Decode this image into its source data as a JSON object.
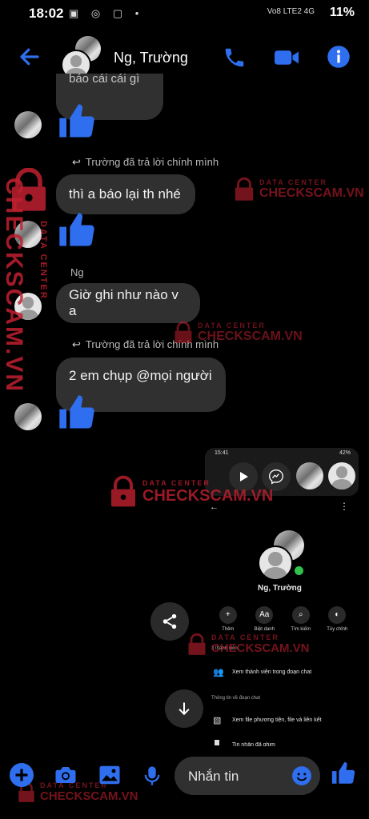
{
  "status_bar": {
    "time": "18:02",
    "battery": "11%",
    "network": "Vo8 LTE2 4G"
  },
  "header": {
    "title": "Ng, Trường"
  },
  "messages": {
    "msg1_partial": "báo cái cái gì",
    "reply_note_1": "Trường đã trả lời chính mình",
    "msg2": "thì a báo lại th nhé",
    "sender_ng": "Ng",
    "msg3": "Giờ ghi như nào v a",
    "reply_note_2": "Trường đã trả lời chính mình",
    "msg4": "2 em chụp @mọi người"
  },
  "watermark": {
    "top": "DATA CENTER",
    "main": "CHECKSCAM.VN"
  },
  "shared_screenshot": {
    "time": "15:41",
    "battery": "42%",
    "name": "Ng, Trường",
    "options": [
      "Thêm",
      "Biệt danh",
      "Tìm kiếm",
      "Tùy chỉnh"
    ],
    "members_header": "3 thành viên",
    "members_link": "Xem thành viên trong đoạn chat",
    "info_header": "Thông tin về đoạn chat",
    "media_link": "Xem file phương tiện, file và liên kết",
    "partial_item": "Tin nhắn đã ghim"
  },
  "composer": {
    "placeholder": "Nhắn tin"
  },
  "colors": {
    "accent": "#2f6fef",
    "bubble": "#303030",
    "watermark": "#c0202f"
  }
}
